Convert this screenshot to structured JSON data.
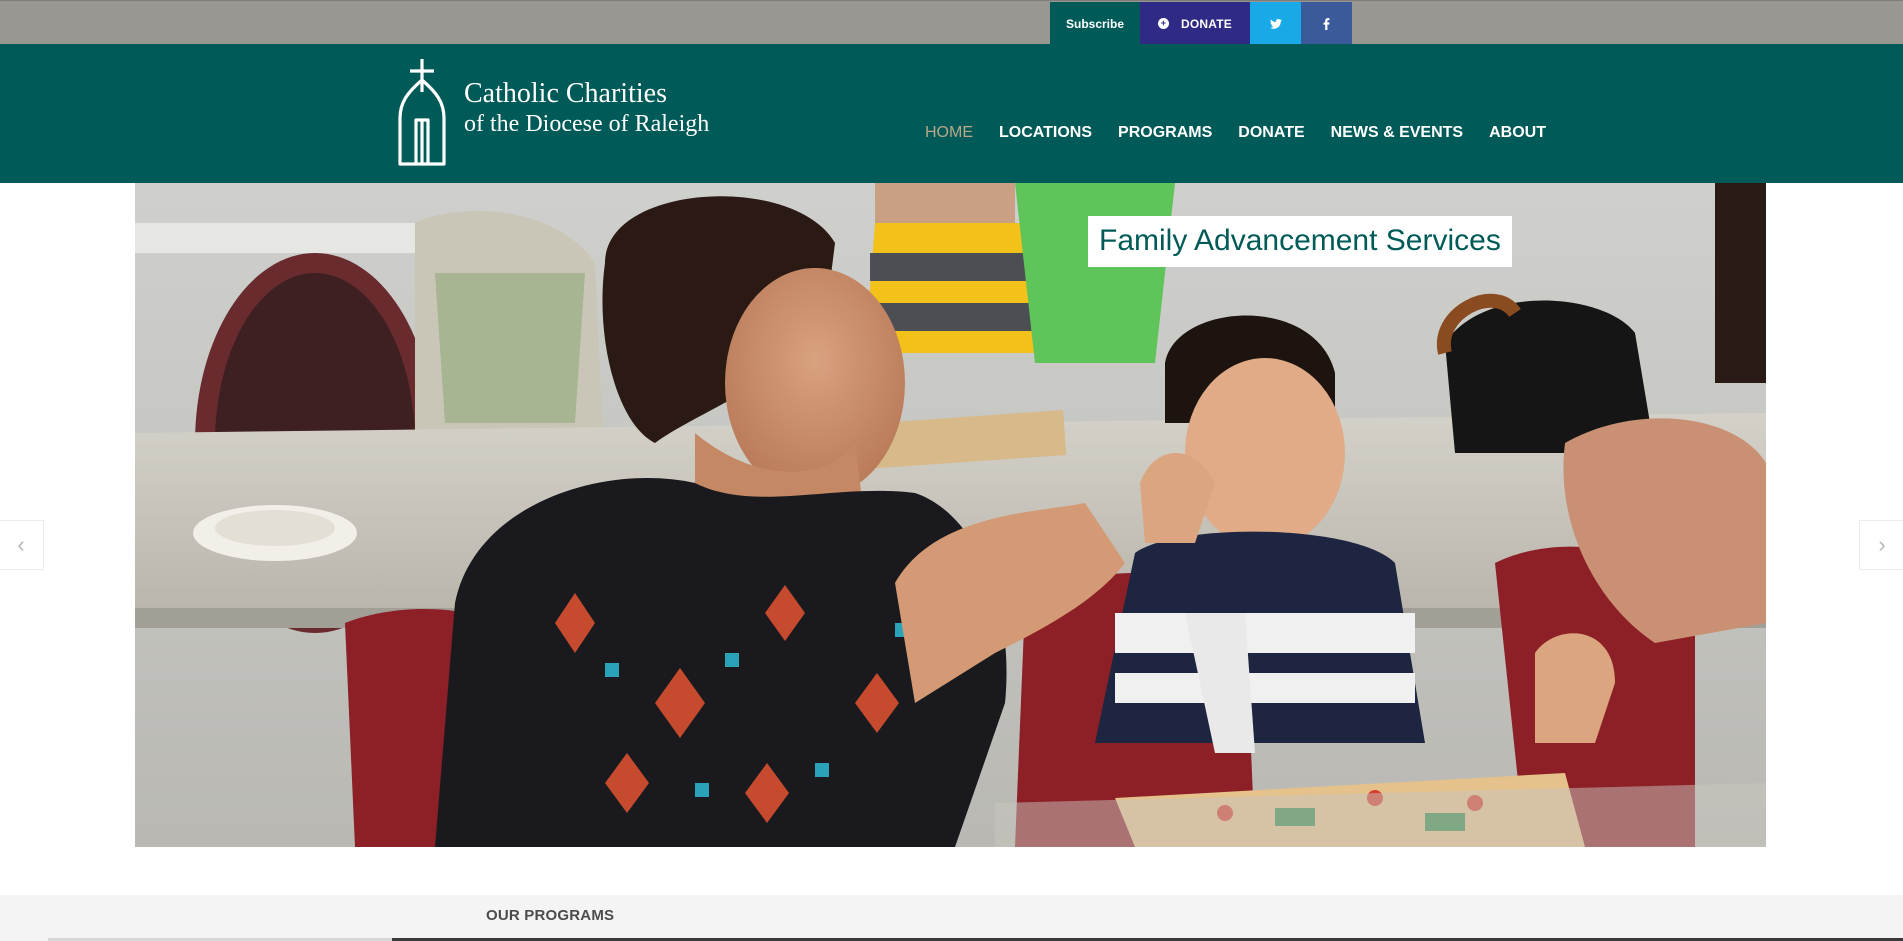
{
  "topbar": {
    "subscribe_label": "Subscribe",
    "donate_label": "DONATE",
    "donate_icon": "plus-circle-icon",
    "twitter_icon": "twitter-icon",
    "facebook_icon": "facebook-icon",
    "colors": {
      "bar": "#999792",
      "subscribe": "#005a57",
      "donate": "#2e2a86",
      "twitter": "#19a9e6",
      "facebook": "#3b5a9a"
    }
  },
  "header": {
    "logo": {
      "line1": "Catholic Charities",
      "line2": "of the Diocese of Raleigh",
      "icon": "cross-church-logo-icon"
    },
    "nav": [
      {
        "label": "HOME",
        "active": true
      },
      {
        "label": "LOCATIONS",
        "active": false
      },
      {
        "label": "PROGRAMS",
        "active": false
      },
      {
        "label": "DONATE",
        "active": false
      },
      {
        "label": "NEWS & EVENTS",
        "active": false
      },
      {
        "label": "ABOUT",
        "active": false
      }
    ],
    "colors": {
      "background": "#005a57",
      "active_link": "#b9a98a"
    }
  },
  "slider": {
    "caption": "Family Advancement Services",
    "image": "photo-woman-and-boy-clapping-at-table",
    "prev_icon": "chevron-left-icon",
    "next_icon": "chevron-right-icon"
  },
  "programs": {
    "title": "OUR PROGRAMS"
  }
}
